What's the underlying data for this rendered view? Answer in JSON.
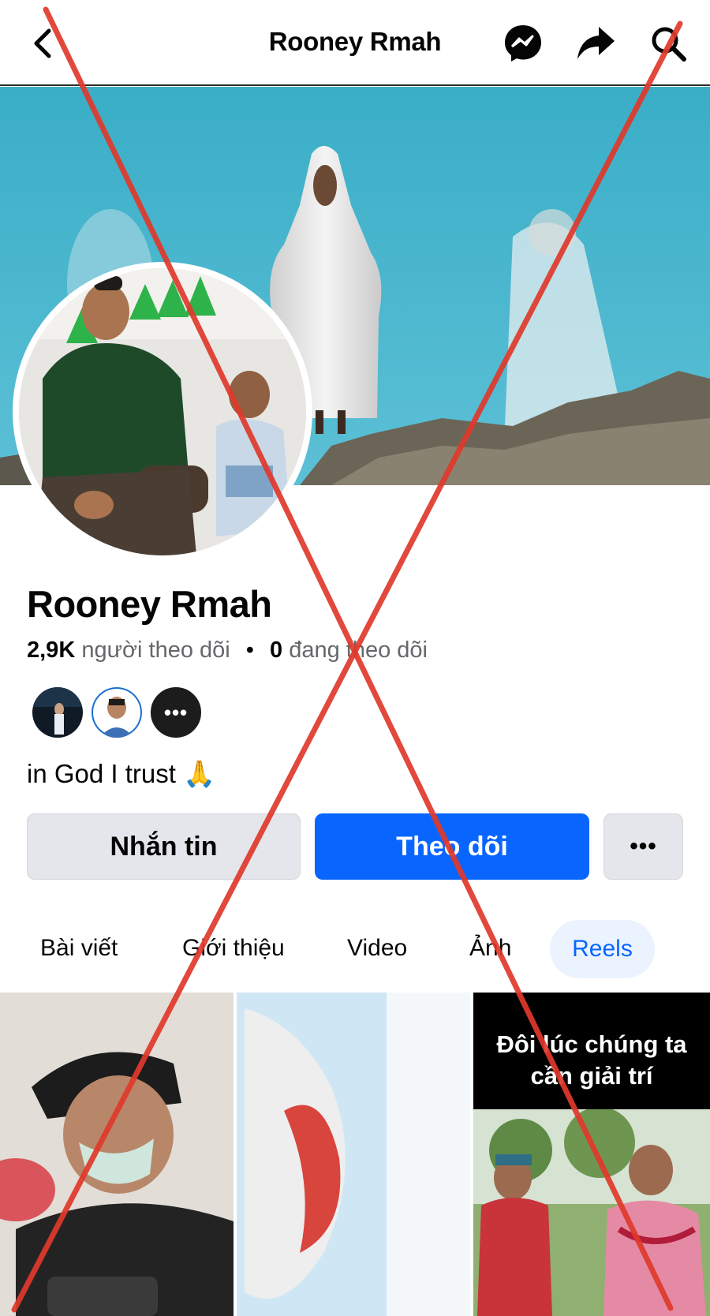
{
  "header": {
    "title": "Rooney Rmah",
    "icons": [
      "back-arrow-icon",
      "messenger-icon",
      "share-icon",
      "search-icon"
    ]
  },
  "profile": {
    "name": "Rooney Rmah",
    "followers_count": "2,9K",
    "followers_label": "người theo dõi",
    "separator": "•",
    "following_count": "0",
    "following_label": "đang theo dõi",
    "friends_more": "•••",
    "bio": "in God I trust 🙏"
  },
  "actions": {
    "message_label": "Nhắn tin",
    "follow_label": "Theo dõi",
    "more_label": "•••"
  },
  "tabs": [
    {
      "label": "Bài viết",
      "active": false
    },
    {
      "label": "Giới thiệu",
      "active": false
    },
    {
      "label": "Video",
      "active": false
    },
    {
      "label": "Ảnh",
      "active": false
    },
    {
      "label": "Reels",
      "active": true
    }
  ],
  "reels": {
    "caption_line1": "Đôi lúc chúng ta",
    "caption_line2": "cần giải trí"
  },
  "colors": {
    "accent": "#0866ff",
    "active_tab_bg": "#ebf3ff",
    "overlay_x": "#e0392b"
  }
}
